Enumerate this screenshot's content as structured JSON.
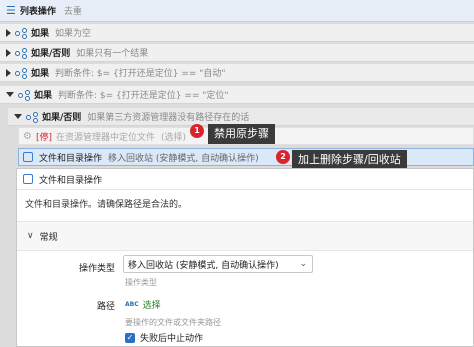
{
  "header": {
    "title": "列表操作",
    "subtitle": "去重"
  },
  "rows": [
    {
      "main": "如果",
      "sub": "如果为空"
    },
    {
      "main": "如果/否则",
      "sub": "如果只有一个结果"
    },
    {
      "main": "如果",
      "sub": "判断条件: $= {打开还是定位} == \"自动\""
    },
    {
      "main": "如果",
      "sub": "判断条件: $= {打开还是定位} == \"定位\""
    }
  ],
  "nested": {
    "main": "如果/否则",
    "sub": "如果第三方资源管理器没有路径存在的话"
  },
  "disabled_step": {
    "tag": "[停]",
    "text": "在资源管理器中定位文件",
    "sub": "(选择)"
  },
  "selected_step": {
    "main": "文件和目录操作",
    "sub": "移入回收站 (安静模式, 自动确认操作)"
  },
  "callouts": [
    {
      "num": "1",
      "text": "禁用原步骤"
    },
    {
      "num": "2",
      "text": "加上删除步骤/回收站"
    }
  ],
  "panel": {
    "title": "文件和目录操作",
    "description": "文件和目录操作。请确保路径是合法的。",
    "section": "常规",
    "op_type_label": "操作类型",
    "op_type_value": "移入回收站 (安静模式, 自动确认操作)",
    "op_type_hint": "操作类型",
    "path_label": "路径",
    "path_abc": "ABC",
    "path_value": "选择",
    "path_hint": "要操作的文件或文件夹路径",
    "checkbox_label": "失败后中止动作"
  }
}
